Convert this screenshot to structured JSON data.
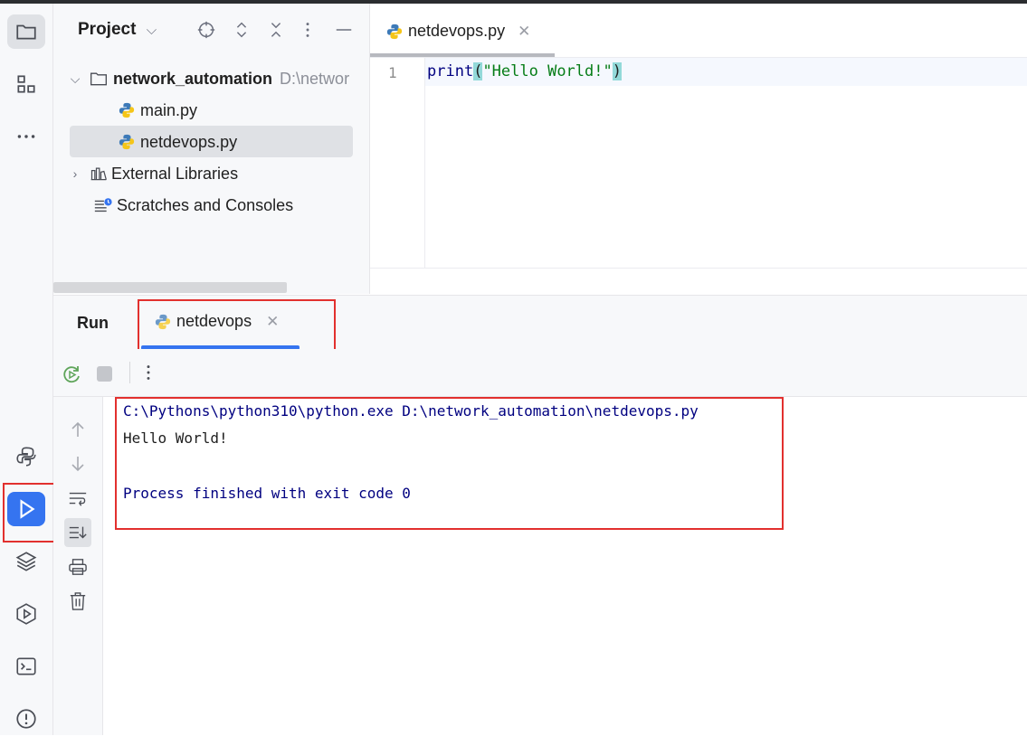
{
  "project_panel": {
    "title": "Project",
    "title_chevron": "⌵",
    "tools": [
      "locate-icon",
      "expand-collapse-icon",
      "close-icon",
      "kebab-icon",
      "minimize-icon"
    ],
    "root_name": "network_automation",
    "root_path": "D:\\networ",
    "files": [
      "main.py",
      "netdevops.py"
    ],
    "external_libraries": "External Libraries",
    "scratches": "Scratches and Consoles"
  },
  "editor": {
    "tab_label": "netdevops.py",
    "line_number": "1",
    "code_func": "print",
    "code_open": "(",
    "code_string": "\"Hello World!\"",
    "code_close": ")"
  },
  "run_panel": {
    "label": "Run",
    "tab_label": "netdevops",
    "console": {
      "command": "C:\\Pythons\\python310\\python.exe D:\\network_automation\\netdevops.py",
      "output": "Hello World!",
      "exit_message": "Process finished with exit code 0"
    }
  },
  "colors": {
    "accent": "#3574f0",
    "highlight_box": "#e2302e",
    "console_text": "#000080"
  }
}
